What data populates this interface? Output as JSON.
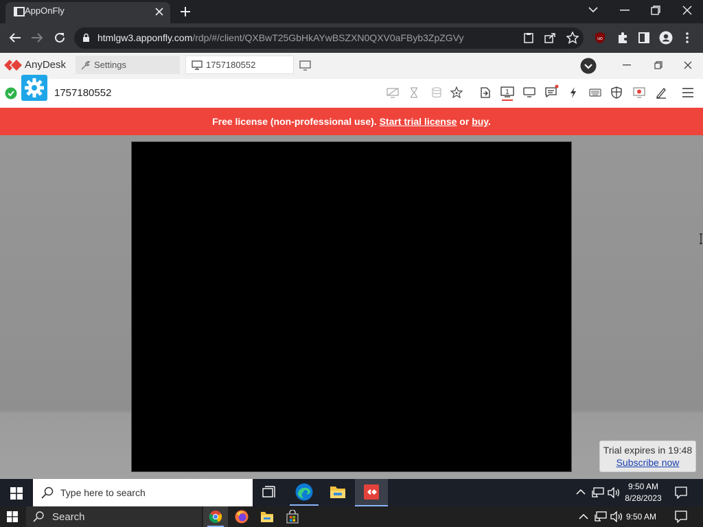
{
  "browser": {
    "tab_title": "AppOnFly",
    "url_host": "htmlgw3.apponfly.com",
    "url_path": "/rdp/#/client/QXBwT25GbHkAYwBSZXN0QXV0aFByb3ZpZGVy"
  },
  "anydesk": {
    "brand": "AnyDesk",
    "settings_tab": "Settings",
    "session_tab": "1757180552",
    "address": "1757180552"
  },
  "banner": {
    "text_before": "Free license (non-professional use). ",
    "trial_link": "Start trial license",
    "middle": " or ",
    "buy_link": "buy",
    "end": "."
  },
  "trial": {
    "expires": "Trial expires in 19:48",
    "subscribe": "Subscribe now"
  },
  "remote_taskbar": {
    "search_placeholder": "Type here to search",
    "time": "9:50 AM",
    "date": "8/28/2023"
  },
  "local_taskbar": {
    "search_label": "Search",
    "time": "9:50 AM"
  },
  "colors": {
    "banner": "#ef443b",
    "anydesk_red": "#e3423b",
    "status_green": "#2db34a",
    "settings_blue": "#1ea6e8"
  }
}
